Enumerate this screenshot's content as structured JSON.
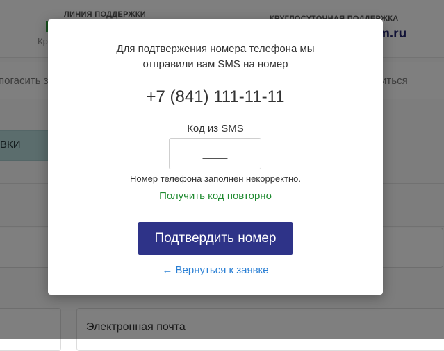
{
  "background": {
    "support_label": "ЛИНИЯ ПОДДЕРЖКИ",
    "support_sub": "Кр",
    "roundclock_label": "КРУГЛОСУТОЧНАЯ ПОДДЕРЖКА",
    "domain_fragment": "m.ru",
    "nav_left": "погасить з",
    "nav_right": "иться",
    "tab_fragment": "ВКИ",
    "email_label": "Электронная почта"
  },
  "modal": {
    "message_line1": "Для подтвержения номера телефона мы",
    "message_line2": "отправили вам SMS на номер",
    "phone": "+7 (841) 111-11-11",
    "code_label": "Код из SMS",
    "code_placeholder": "____",
    "code_value": "",
    "error_text": "Номер телефона заполнен некорректно.",
    "resend_link": "Получить код повторно",
    "confirm_button": "Подтвердить номер",
    "back_arrow": "←",
    "back_link": "Вернуться к заявке"
  },
  "colors": {
    "confirm_button_bg": "#2e3388",
    "resend_link": "#1e8a2f",
    "back_link": "#2a7fd4",
    "overlay": "rgba(0,0,0,0.5)",
    "tab_bg": "#b6dadb",
    "domain_text": "#23246e"
  }
}
